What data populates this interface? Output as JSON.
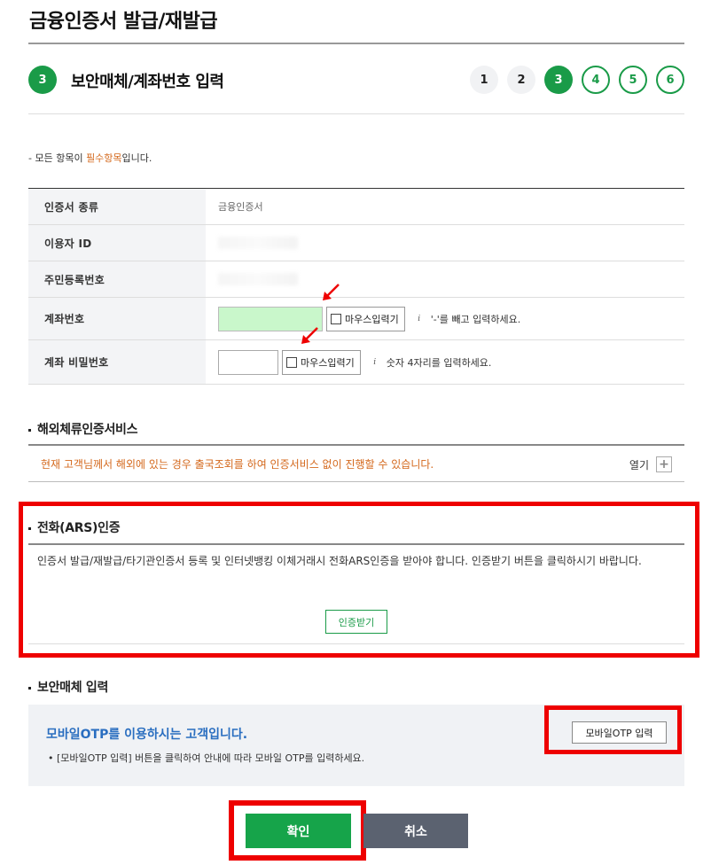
{
  "page": {
    "title": "금융인증서 발급/재발급"
  },
  "step": {
    "number": "3",
    "title": "보안매체/계좌번호 입력",
    "nav": [
      "1",
      "2",
      "3",
      "4",
      "5",
      "6"
    ]
  },
  "notice": {
    "prefix": "- 모든 항목이 ",
    "required": "필수항목",
    "suffix": "입니다."
  },
  "form": {
    "cert_type_label": "인증서 종류",
    "cert_type_value": "금융인증서",
    "user_id_label": "이용자 ID",
    "resident_no_label": "주민등록번호",
    "account_label": "계좌번호",
    "account_mouse_label": "마우스입력기",
    "account_hint": "'-'를 빼고 입력하세요.",
    "password_label": "계좌 비밀번호",
    "password_mouse_label": "마우스입력기",
    "password_hint": "숫자 4자리를 입력하세요."
  },
  "overseas": {
    "title": "해외체류인증서비스",
    "text": "현재 고객님께서 해외에 있는 경우 출국조회를 하여 인증서비스 없이 진행할 수 있습니다.",
    "open_label": "열기"
  },
  "ars": {
    "title": "전화(ARS)인증",
    "body": "인증서 발급/재발급/타기관인증서 등록 및 인터넷뱅킹 이체거래시 전화ARS인증을 받아야 합니다. 인증받기 버튼을 클릭하시기 바랍니다.",
    "button": "인증받기"
  },
  "security": {
    "title": "보안매체 입력",
    "otp_title": "모바일OTP를 이용하시는 고객입니다.",
    "otp_desc": "• [모바일OTP 입력] 버튼을 클릭하여 안내에 따라 모바일 OTP를 입력하세요.",
    "otp_button": "모바일OTP 입력"
  },
  "actions": {
    "confirm": "확인",
    "cancel": "취소"
  },
  "colors": {
    "brand_green": "#1a9b48",
    "highlight_red": "#ee0000",
    "notice_orange": "#d4681c",
    "otp_blue": "#2a6ec0"
  }
}
